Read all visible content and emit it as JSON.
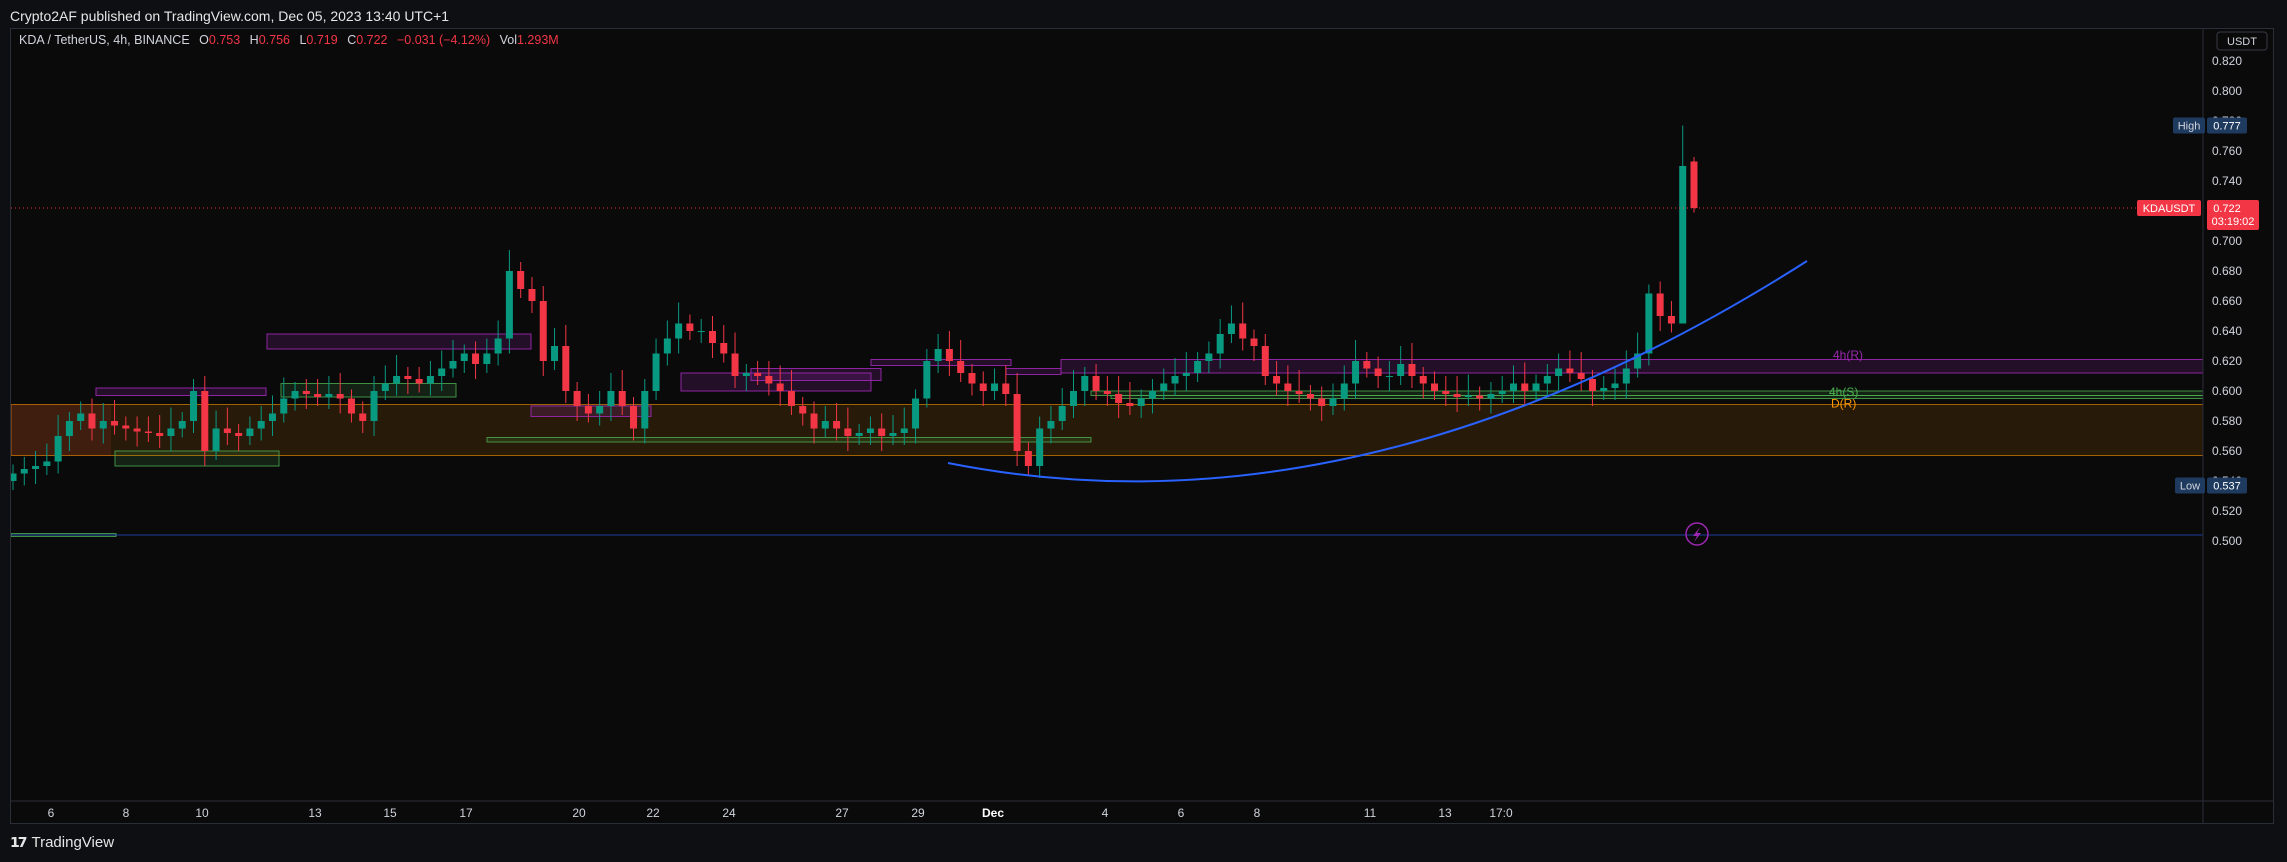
{
  "publisher_line": "Crypto2AF published on TradingView.com, Dec 05, 2023 13:40 UTC+1",
  "footer": {
    "brand": "TradingView"
  },
  "legend": {
    "symbol": "KDA / TetherUS, 4h, BINANCE",
    "o_label": "O",
    "o": "0.753",
    "h_label": "H",
    "h": "0.756",
    "l_label": "L",
    "l": "0.719",
    "c_label": "C",
    "c": "0.722",
    "change": "−0.031 (−4.12%)",
    "vol_label": "Vol",
    "vol": "1.293M"
  },
  "axis": {
    "currency": "USDT",
    "high_label": "High",
    "high_value": "0.777",
    "low_label": "Low",
    "low_value": "0.537",
    "price_label": "KDAUSDT",
    "price_value": "0.722",
    "countdown": "03:19:02"
  },
  "colors": {
    "up": "#089981",
    "down": "#f23645",
    "bg": "#0a0a0b",
    "text": "#d1d4dc",
    "curve": "#2962ff",
    "ob_purple": "#9c27b0",
    "ob_green": "#4caf50",
    "zone_orange": "#ff9800"
  },
  "zone_labels": {
    "r4h": "4h(R)",
    "s4h": "4h(S)",
    "rd": "D(R)"
  },
  "chart_data": {
    "type": "candlestick",
    "symbol": "KDA / TetherUS",
    "timeframe": "4h",
    "exchange": "BINANCE",
    "ylim": [
      0.5,
      0.83
    ],
    "yticks": [
      0.5,
      0.52,
      0.54,
      0.56,
      0.58,
      0.6,
      0.62,
      0.64,
      0.66,
      0.68,
      0.7,
      0.72,
      0.74,
      0.76,
      0.78,
      0.8,
      0.82
    ],
    "x_ticks": [
      "6",
      "8",
      "10",
      "13",
      "15",
      "17",
      "20",
      "22",
      "24",
      "27",
      "29",
      "Dec",
      "4",
      "6",
      "8",
      "11",
      "13",
      "17:0"
    ],
    "current_price": 0.722,
    "high": 0.777,
    "low": 0.537,
    "closes": [
      0.545,
      0.548,
      0.55,
      0.553,
      0.57,
      0.58,
      0.585,
      0.575,
      0.58,
      0.577,
      0.575,
      0.573,
      0.572,
      0.57,
      0.575,
      0.58,
      0.6,
      0.56,
      0.575,
      0.572,
      0.57,
      0.575,
      0.58,
      0.585,
      0.595,
      0.6,
      0.598,
      0.596,
      0.598,
      0.595,
      0.585,
      0.58,
      0.6,
      0.605,
      0.61,
      0.608,
      0.605,
      0.61,
      0.615,
      0.62,
      0.625,
      0.618,
      0.625,
      0.635,
      0.68,
      0.668,
      0.66,
      0.62,
      0.63,
      0.6,
      0.59,
      0.585,
      0.59,
      0.6,
      0.59,
      0.575,
      0.6,
      0.625,
      0.635,
      0.645,
      0.64,
      0.64,
      0.632,
      0.625,
      0.61,
      0.612,
      0.61,
      0.605,
      0.6,
      0.59,
      0.585,
      0.575,
      0.58,
      0.575,
      0.57,
      0.572,
      0.575,
      0.57,
      0.572,
      0.575,
      0.595,
      0.62,
      0.628,
      0.62,
      0.612,
      0.605,
      0.6,
      0.605,
      0.598,
      0.56,
      0.55,
      0.575,
      0.58,
      0.59,
      0.6,
      0.61,
      0.6,
      0.598,
      0.592,
      0.59,
      0.595,
      0.6,
      0.605,
      0.61,
      0.612,
      0.62,
      0.625,
      0.638,
      0.645,
      0.635,
      0.63,
      0.61,
      0.605,
      0.6,
      0.598,
      0.595,
      0.59,
      0.595,
      0.605,
      0.62,
      0.615,
      0.61,
      0.61,
      0.618,
      0.61,
      0.605,
      0.6,
      0.598,
      0.596,
      0.597,
      0.595,
      0.598,
      0.6,
      0.605,
      0.6,
      0.605,
      0.61,
      0.615,
      0.612,
      0.608,
      0.6,
      0.602,
      0.605,
      0.615,
      0.625,
      0.665,
      0.65,
      0.645,
      0.75,
      0.722
    ]
  }
}
